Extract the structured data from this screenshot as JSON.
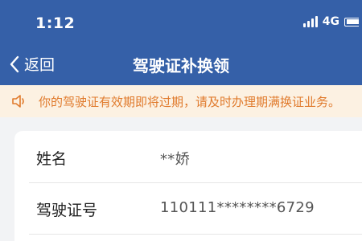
{
  "status_bar": {
    "time": "1:12",
    "network": "4G"
  },
  "nav": {
    "back_label": "返回",
    "title": "驾驶证补换领"
  },
  "notice": {
    "text": "你的驾驶证有效期即将过期，请及时办理期满换证业务。"
  },
  "info": {
    "rows": [
      {
        "label": "姓名",
        "value": "**娇"
      },
      {
        "label": "驾驶证号",
        "value": "110111********6729"
      }
    ]
  },
  "colors": {
    "header_bg": "#3560a8",
    "notice_bg": "#fcf1e2",
    "notice_text": "#e07a2c",
    "page_bg": "#f2f3f5"
  }
}
